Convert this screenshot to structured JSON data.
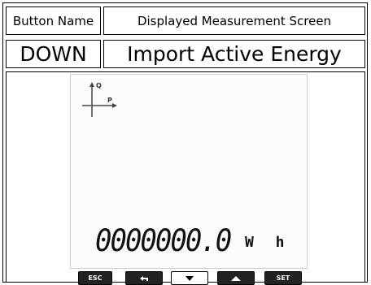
{
  "table": {
    "header_button": "Button Name",
    "header_screen": "Displayed Measurement Screen",
    "button": "DOWN",
    "screen": "Import Active Energy"
  },
  "lcd": {
    "axis_q": "Q",
    "axis_p": "P",
    "value": "0000000.0",
    "unit": "W h"
  },
  "keys": [
    {
      "label": "ESC",
      "icon": "esc-label"
    },
    {
      "label": "",
      "icon": "return-arrow-icon"
    },
    {
      "label": "",
      "icon": "down-triangle-icon"
    },
    {
      "label": "",
      "icon": "up-triangle-icon"
    },
    {
      "label": "SET",
      "icon": "set-label"
    }
  ]
}
